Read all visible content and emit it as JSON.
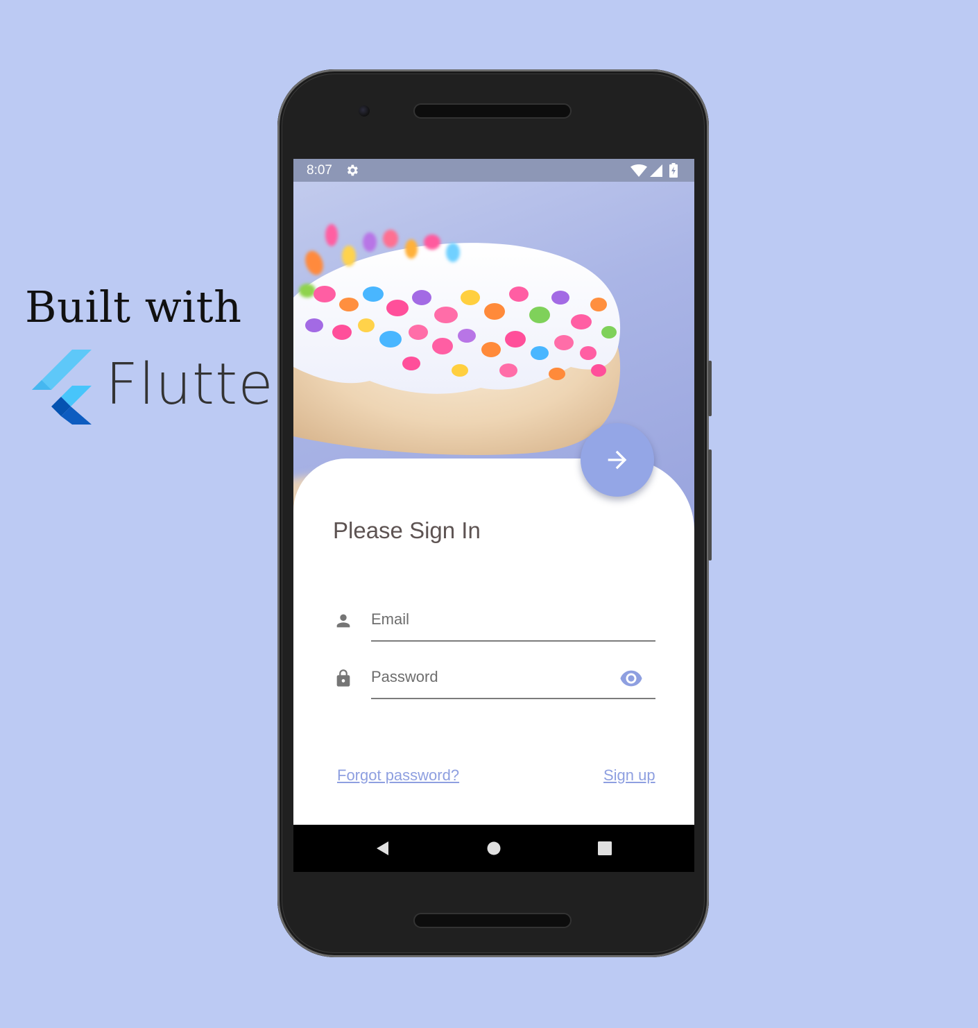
{
  "promo": {
    "heading": "Built with",
    "wordmark": "Flutter",
    "logo_icon": "flutter-logo-icon"
  },
  "status_bar": {
    "time": "8:07",
    "icons": [
      "gear-icon",
      "wifi-icon",
      "signal-icon",
      "battery-charging-icon"
    ]
  },
  "screen": {
    "hero_image": "frosted-donut-with-cereal-sprinkles",
    "submit_icon": "arrow-right-icon",
    "title": "Please Sign In",
    "email": {
      "icon": "person-icon",
      "placeholder": "Email",
      "value": ""
    },
    "password": {
      "icon": "lock-icon",
      "placeholder": "Password",
      "value": "",
      "toggle_icon": "eye-icon"
    },
    "forgot_label": "Forgot password?",
    "signup_label": "Sign up"
  },
  "nav_bar": {
    "icons": [
      "back-icon",
      "home-icon",
      "recents-icon"
    ]
  },
  "colors": {
    "background": "#bccaf3",
    "accent": "#94a6e6",
    "link": "#8e9fe0",
    "title_text": "#5d5352",
    "status_bar": "#8d97b6",
    "phone_body": "#202020"
  }
}
